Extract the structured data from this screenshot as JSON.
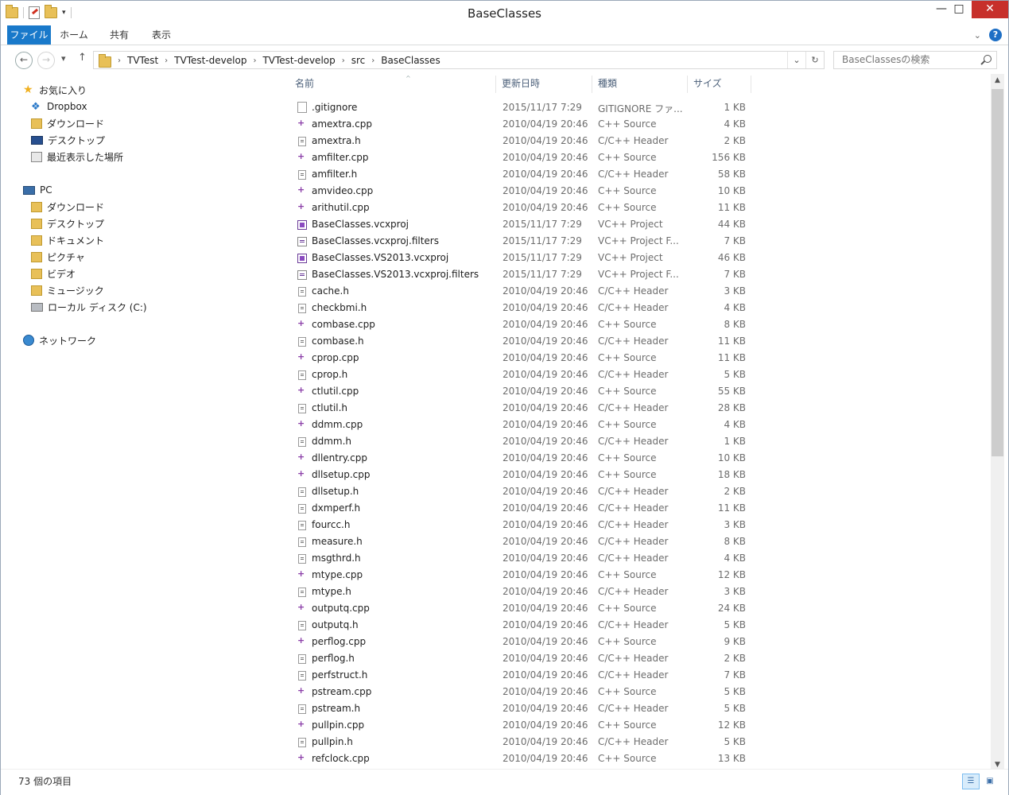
{
  "window": {
    "title": "BaseClasses",
    "min": "—",
    "max": "□",
    "close": "✕"
  },
  "ribbon": {
    "tabs": [
      "ファイル",
      "ホーム",
      "共有",
      "表示"
    ]
  },
  "nav": {
    "back": "←",
    "forward": "→",
    "recent": "▾",
    "up": "↑",
    "breadcrumbs": [
      "TVTest",
      "TVTest-develop",
      "TVTest-develop",
      "src",
      "BaseClasses"
    ],
    "search_placeholder": "BaseClassesの検索"
  },
  "navpane": {
    "favorites_label": "お気に入り",
    "favorites": [
      "Dropbox",
      "ダウンロード",
      "デスクトップ",
      "最近表示した場所"
    ],
    "pc_label": "PC",
    "pc_items": [
      "ダウンロード",
      "デスクトップ",
      "ドキュメント",
      "ピクチャ",
      "ビデオ",
      "ミュージック",
      "ローカル ディスク (C:)"
    ],
    "network_label": "ネットワーク"
  },
  "columns": {
    "name": "名前",
    "date": "更新日時",
    "type": "種類",
    "size": "サイズ"
  },
  "files": [
    {
      "name": ".gitignore",
      "date": "2015/11/17 7:29",
      "type": "GITIGNORE ファ...",
      "size": "1 KB",
      "icon": "gen"
    },
    {
      "name": "amextra.cpp",
      "date": "2010/04/19 20:46",
      "type": "C++ Source",
      "size": "4 KB",
      "icon": "cpp"
    },
    {
      "name": "amextra.h",
      "date": "2010/04/19 20:46",
      "type": "C/C++ Header",
      "size": "2 KB",
      "icon": "h"
    },
    {
      "name": "amfilter.cpp",
      "date": "2010/04/19 20:46",
      "type": "C++ Source",
      "size": "156 KB",
      "icon": "cpp"
    },
    {
      "name": "amfilter.h",
      "date": "2010/04/19 20:46",
      "type": "C/C++ Header",
      "size": "58 KB",
      "icon": "h"
    },
    {
      "name": "amvideo.cpp",
      "date": "2010/04/19 20:46",
      "type": "C++ Source",
      "size": "10 KB",
      "icon": "cpp"
    },
    {
      "name": "arithutil.cpp",
      "date": "2010/04/19 20:46",
      "type": "C++ Source",
      "size": "11 KB",
      "icon": "cpp"
    },
    {
      "name": "BaseClasses.vcxproj",
      "date": "2015/11/17 7:29",
      "type": "VC++ Project",
      "size": "44 KB",
      "icon": "proj"
    },
    {
      "name": "BaseClasses.vcxproj.filters",
      "date": "2015/11/17 7:29",
      "type": "VC++ Project F...",
      "size": "7 KB",
      "icon": "filt"
    },
    {
      "name": "BaseClasses.VS2013.vcxproj",
      "date": "2015/11/17 7:29",
      "type": "VC++ Project",
      "size": "46 KB",
      "icon": "proj"
    },
    {
      "name": "BaseClasses.VS2013.vcxproj.filters",
      "date": "2015/11/17 7:29",
      "type": "VC++ Project F...",
      "size": "7 KB",
      "icon": "filt"
    },
    {
      "name": "cache.h",
      "date": "2010/04/19 20:46",
      "type": "C/C++ Header",
      "size": "3 KB",
      "icon": "h"
    },
    {
      "name": "checkbmi.h",
      "date": "2010/04/19 20:46",
      "type": "C/C++ Header",
      "size": "4 KB",
      "icon": "h"
    },
    {
      "name": "combase.cpp",
      "date": "2010/04/19 20:46",
      "type": "C++ Source",
      "size": "8 KB",
      "icon": "cpp"
    },
    {
      "name": "combase.h",
      "date": "2010/04/19 20:46",
      "type": "C/C++ Header",
      "size": "11 KB",
      "icon": "h"
    },
    {
      "name": "cprop.cpp",
      "date": "2010/04/19 20:46",
      "type": "C++ Source",
      "size": "11 KB",
      "icon": "cpp"
    },
    {
      "name": "cprop.h",
      "date": "2010/04/19 20:46",
      "type": "C/C++ Header",
      "size": "5 KB",
      "icon": "h"
    },
    {
      "name": "ctlutil.cpp",
      "date": "2010/04/19 20:46",
      "type": "C++ Source",
      "size": "55 KB",
      "icon": "cpp"
    },
    {
      "name": "ctlutil.h",
      "date": "2010/04/19 20:46",
      "type": "C/C++ Header",
      "size": "28 KB",
      "icon": "h"
    },
    {
      "name": "ddmm.cpp",
      "date": "2010/04/19 20:46",
      "type": "C++ Source",
      "size": "4 KB",
      "icon": "cpp"
    },
    {
      "name": "ddmm.h",
      "date": "2010/04/19 20:46",
      "type": "C/C++ Header",
      "size": "1 KB",
      "icon": "h"
    },
    {
      "name": "dllentry.cpp",
      "date": "2010/04/19 20:46",
      "type": "C++ Source",
      "size": "10 KB",
      "icon": "cpp"
    },
    {
      "name": "dllsetup.cpp",
      "date": "2010/04/19 20:46",
      "type": "C++ Source",
      "size": "18 KB",
      "icon": "cpp"
    },
    {
      "name": "dllsetup.h",
      "date": "2010/04/19 20:46",
      "type": "C/C++ Header",
      "size": "2 KB",
      "icon": "h"
    },
    {
      "name": "dxmperf.h",
      "date": "2010/04/19 20:46",
      "type": "C/C++ Header",
      "size": "11 KB",
      "icon": "h"
    },
    {
      "name": "fourcc.h",
      "date": "2010/04/19 20:46",
      "type": "C/C++ Header",
      "size": "3 KB",
      "icon": "h"
    },
    {
      "name": "measure.h",
      "date": "2010/04/19 20:46",
      "type": "C/C++ Header",
      "size": "8 KB",
      "icon": "h"
    },
    {
      "name": "msgthrd.h",
      "date": "2010/04/19 20:46",
      "type": "C/C++ Header",
      "size": "4 KB",
      "icon": "h"
    },
    {
      "name": "mtype.cpp",
      "date": "2010/04/19 20:46",
      "type": "C++ Source",
      "size": "12 KB",
      "icon": "cpp"
    },
    {
      "name": "mtype.h",
      "date": "2010/04/19 20:46",
      "type": "C/C++ Header",
      "size": "3 KB",
      "icon": "h"
    },
    {
      "name": "outputq.cpp",
      "date": "2010/04/19 20:46",
      "type": "C++ Source",
      "size": "24 KB",
      "icon": "cpp"
    },
    {
      "name": "outputq.h",
      "date": "2010/04/19 20:46",
      "type": "C/C++ Header",
      "size": "5 KB",
      "icon": "h"
    },
    {
      "name": "perflog.cpp",
      "date": "2010/04/19 20:46",
      "type": "C++ Source",
      "size": "9 KB",
      "icon": "cpp"
    },
    {
      "name": "perflog.h",
      "date": "2010/04/19 20:46",
      "type": "C/C++ Header",
      "size": "2 KB",
      "icon": "h"
    },
    {
      "name": "perfstruct.h",
      "date": "2010/04/19 20:46",
      "type": "C/C++ Header",
      "size": "7 KB",
      "icon": "h"
    },
    {
      "name": "pstream.cpp",
      "date": "2010/04/19 20:46",
      "type": "C++ Source",
      "size": "5 KB",
      "icon": "cpp"
    },
    {
      "name": "pstream.h",
      "date": "2010/04/19 20:46",
      "type": "C/C++ Header",
      "size": "5 KB",
      "icon": "h"
    },
    {
      "name": "pullpin.cpp",
      "date": "2010/04/19 20:46",
      "type": "C++ Source",
      "size": "12 KB",
      "icon": "cpp"
    },
    {
      "name": "pullpin.h",
      "date": "2010/04/19 20:46",
      "type": "C/C++ Header",
      "size": "5 KB",
      "icon": "h"
    },
    {
      "name": "refclock.cpp",
      "date": "2010/04/19 20:46",
      "type": "C++ Source",
      "size": "13 KB",
      "icon": "cpp"
    }
  ],
  "status": {
    "item_count": "73 個の項目"
  },
  "colors": {
    "accent": "#1979ca",
    "close": "#c7302b"
  }
}
